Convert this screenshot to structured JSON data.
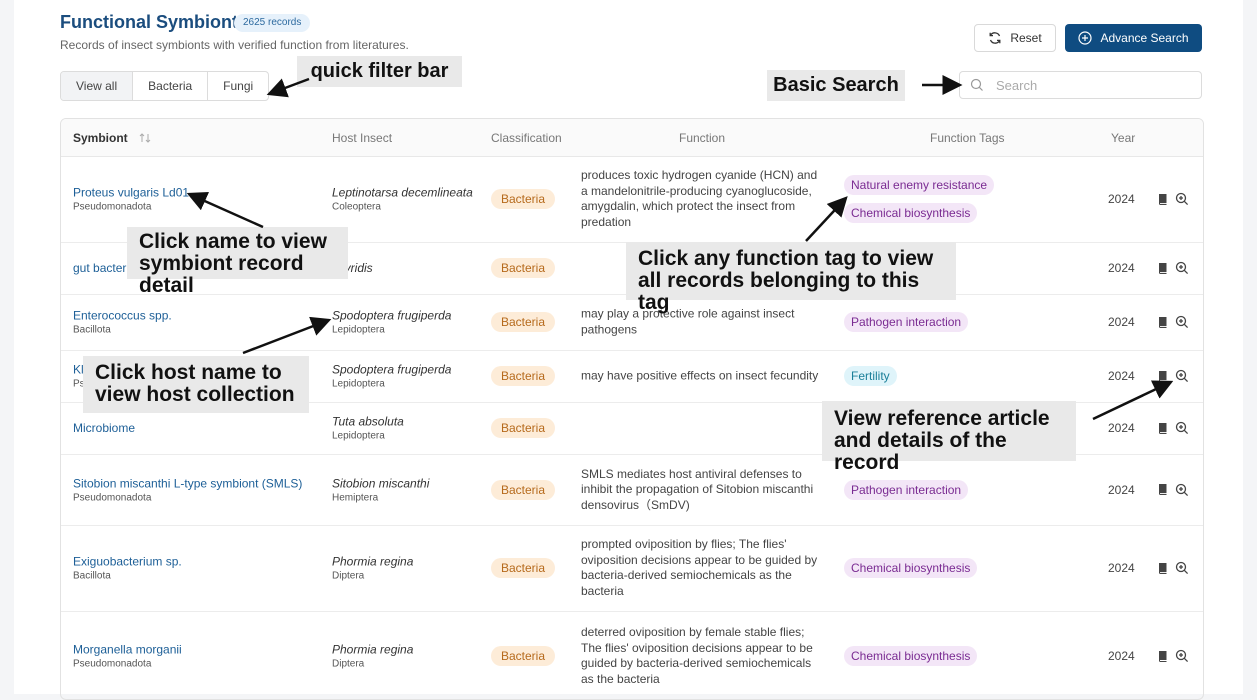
{
  "header": {
    "title": "Functional Symbionts",
    "record_count": "2625 records",
    "subtitle": "Records of insect symbionts with verified function from literatures.",
    "reset_label": "Reset",
    "advance_search_label": "Advance Search"
  },
  "filters": {
    "items": [
      "View all",
      "Bacteria",
      "Fungi"
    ],
    "active": "View all"
  },
  "search": {
    "placeholder": "Search"
  },
  "table": {
    "columns": {
      "symbiont": "Symbiont",
      "host": "Host Insect",
      "classification": "Classification",
      "function": "Function",
      "tags": "Function Tags",
      "year": "Year"
    },
    "rows": [
      {
        "symbiont": "Proteus vulgaris Ld01",
        "phylum": "Pseudomonadota",
        "host": "Leptinotarsa decemlineata",
        "order": "Coleoptera",
        "classification": "Bacteria",
        "function": "produces toxic hydrogen cyanide (HCN) and a mandelonitrile-producing cyanoglucoside, amygdalin, which protect the insect from predation",
        "tags": [
          "Natural enemy resistance",
          "Chemical biosynthesis"
        ],
        "year": "2024"
      },
      {
        "symbiont": "gut bacteria",
        "phylum": "",
        "host": "axyridis",
        "order": "",
        "classification": "Bacteria",
        "function": "",
        "tags": [],
        "year": "2024"
      },
      {
        "symbiont": "Enterococcus spp.",
        "phylum": "Bacillota",
        "host": "Spodoptera frugiperda",
        "order": "Lepidoptera",
        "classification": "Bacteria",
        "function": "may play a protective role against insect pathogens",
        "tags": [
          "Pathogen interaction"
        ],
        "year": "2024"
      },
      {
        "symbiont": "Kleb",
        "phylum": "Pseu",
        "host": "Spodoptera frugiperda",
        "order": "Lepidoptera",
        "classification": "Bacteria",
        "function": "may have positive effects on insect fecundity",
        "tags": [
          "Fertility"
        ],
        "year": "2024"
      },
      {
        "symbiont": "Microbiome",
        "phylum": "",
        "host": "Tuta absoluta",
        "order": "Lepidoptera",
        "classification": "Bacteria",
        "function": "",
        "tags": [],
        "year": "2024"
      },
      {
        "symbiont": "Sitobion miscanthi L-type symbiont (SMLS)",
        "phylum": "Pseudomonadota",
        "host": "Sitobion miscanthi",
        "order": "Hemiptera",
        "classification": "Bacteria",
        "function": "SMLS mediates host antiviral defenses to inhibit the propagation of Sitobion miscanthi densovirus（SmDV)",
        "tags": [
          "Pathogen interaction"
        ],
        "year": "2024"
      },
      {
        "symbiont": "Exiguobacterium sp.",
        "phylum": "Bacillota",
        "host": "Phormia regina",
        "order": "Diptera",
        "classification": "Bacteria",
        "function": "prompted oviposition by flies; The flies' oviposition decisions appear to be guided by bacteria-derived semiochemicals as the bacteria",
        "tags": [
          "Chemical biosynthesis"
        ],
        "year": "2024"
      },
      {
        "symbiont": "Morganella morganii",
        "phylum": "Pseudomonadota",
        "host": "Phormia regina",
        "order": "Diptera",
        "classification": "Bacteria",
        "function": "deterred oviposition by female stable flies; The flies' oviposition decisions appear to be guided by bacteria-derived semiochemicals as the bacteria",
        "tags": [
          "Chemical biosynthesis"
        ],
        "year": "2024"
      }
    ]
  },
  "annotations": {
    "quick_filter": "quick filter bar",
    "basic_search": "Basic Search",
    "click_name": [
      "Click name to view",
      "symbiont record detail"
    ],
    "click_tag": [
      "Click any function tag to view",
      "all records belonging to this tag"
    ],
    "click_host": [
      "Click host name to",
      "view host collection"
    ],
    "view_ref": [
      "View reference article",
      "and details of the record"
    ]
  },
  "colors": {
    "accent": "#0f4c81",
    "link": "#1d5f97",
    "tag_bg": "#f3e6f7",
    "bacteria_bg": "#fdecd8"
  }
}
